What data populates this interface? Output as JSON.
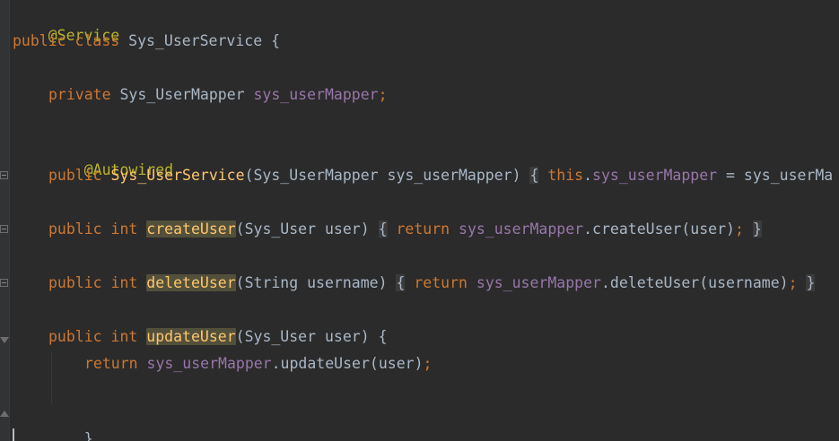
{
  "code": {
    "line1": {
      "annotation": "@Service"
    },
    "line2": {
      "kw1": "public",
      "kw2": "class",
      "name": "Sys_UserService",
      "brace": "{"
    },
    "line4": {
      "kw": "private",
      "type": "Sys_UserMapper",
      "field": "sys_userMapper",
      "semi": ";"
    },
    "line6": {
      "annotation": "@Autowired"
    },
    "line7": {
      "kw": "public",
      "name": "Sys_UserService",
      "params": "(Sys_UserMapper sys_userMapper)",
      "open": "{",
      "this": "this",
      "dot": ".",
      "field": "sys_userMapper",
      "rest": " = sys_userMa"
    },
    "line9": {
      "kw1": "public",
      "kw2": "int",
      "name": "createUser",
      "params": "(Sys_User user)",
      "open": "{",
      "ret": "return",
      "field": "sys_userMapper",
      "call": ".createUser(user)",
      "semi": ";",
      "close": "}"
    },
    "line11": {
      "kw1": "public",
      "kw2": "int",
      "name": "deleteUser",
      "params": "(String username)",
      "open": "{",
      "ret": "return",
      "field": "sys_userMapper",
      "call": ".deleteUser(username)",
      "semi": ";",
      "close": "}"
    },
    "line13": {
      "kw1": "public",
      "kw2": "int",
      "name": "updateUser",
      "params": "(Sys_User user)",
      "open": "{"
    },
    "line14": {
      "ret": "return",
      "field": "sys_userMapper",
      "call": ".updateUser(user)",
      "semi": ";"
    },
    "line16": {
      "close": "}"
    }
  },
  "theme": {
    "background": "#2b2b2b",
    "keyword": "#cc7832",
    "annotation": "#bbb529",
    "field": "#9876aa",
    "text": "#a9b7c6",
    "highlight": "#52503a"
  }
}
